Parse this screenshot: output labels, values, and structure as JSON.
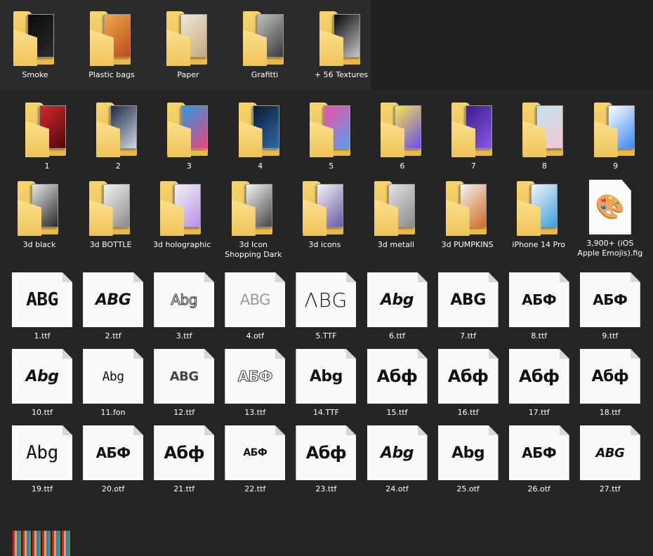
{
  "rows": [
    {
      "id": "textures",
      "kind": "folder",
      "items": [
        {
          "label": "Smoke",
          "colors": [
            "#0a0a0a",
            "#2b2b2b"
          ]
        },
        {
          "label": "Plastic bags",
          "colors": [
            "#f2a94a",
            "#b84a1c"
          ]
        },
        {
          "label": "Paper",
          "colors": [
            "#efe8dc",
            "#c9a77a"
          ]
        },
        {
          "label": "Grafitti",
          "colors": [
            "#c0c0c0",
            "#3a3a3a"
          ]
        },
        {
          "label": "+ 56 Textures",
          "colors": [
            "#050505",
            "#c8c8c8"
          ]
        }
      ]
    },
    {
      "id": "gradients",
      "kind": "folder",
      "items": [
        {
          "label": "1",
          "colors": [
            "#d8262b",
            "#4a0a0c"
          ]
        },
        {
          "label": "2",
          "colors": [
            "#1e2a44",
            "#cfd6e4"
          ]
        },
        {
          "label": "3",
          "colors": [
            "#2b9be0",
            "#e8447a"
          ]
        },
        {
          "label": "4",
          "colors": [
            "#0b1a2e",
            "#2f6aa8"
          ]
        },
        {
          "label": "5",
          "colors": [
            "#f04fa0",
            "#55a0f0"
          ]
        },
        {
          "label": "6",
          "colors": [
            "#f7e64a",
            "#6a4cf0"
          ]
        },
        {
          "label": "7",
          "colors": [
            "#3a1e8a",
            "#8a58e8"
          ]
        },
        {
          "label": "8",
          "colors": [
            "#c6e4ee",
            "#f2c6d4"
          ]
        },
        {
          "label": "9",
          "colors": [
            "#ffffff",
            "#3a88f0"
          ]
        }
      ]
    },
    {
      "id": "3d",
      "kind": "mixed",
      "items": [
        {
          "type": "folder",
          "label": "3d black",
          "colors": [
            "#e6e6e6",
            "#2a2a2a"
          ]
        },
        {
          "type": "folder",
          "label": "3d BOTTLE",
          "colors": [
            "#f2f2f2",
            "#8a8a8a"
          ]
        },
        {
          "type": "folder",
          "label": "3d holographic",
          "colors": [
            "#f3f3f3",
            "#b890e8"
          ]
        },
        {
          "type": "folder",
          "label": "3d Icon\nShopping Dark",
          "colors": [
            "#f4f4f4",
            "#444444"
          ]
        },
        {
          "type": "folder",
          "label": "3d icons",
          "colors": [
            "#f4f4f4",
            "#6a58a8"
          ]
        },
        {
          "type": "folder",
          "label": "3d metall",
          "colors": [
            "#e4e4e4",
            "#8a8a8a"
          ]
        },
        {
          "type": "folder",
          "label": "3d PUMPKINS",
          "colors": [
            "#f4f4f4",
            "#d06a20"
          ]
        },
        {
          "type": "folder",
          "label": "iPhone 14 Pro",
          "colors": [
            "#f4f4f4",
            "#3aa0e0"
          ]
        },
        {
          "type": "figma",
          "label": "3,900+ (iOS\nApple Emojis).fig",
          "icon": "palette-icon"
        }
      ]
    },
    {
      "id": "fonts1",
      "kind": "font",
      "items": [
        {
          "label": "1.ttf",
          "glyph": "ABG"
        },
        {
          "label": "2.ttf",
          "glyph": "ABG"
        },
        {
          "label": "3.ttf",
          "glyph": "Abg"
        },
        {
          "label": "4.otf",
          "glyph": "ABG"
        },
        {
          "label": "5.TTF",
          "glyph": "ΛBG"
        },
        {
          "label": "6.ttf",
          "glyph": "Abg"
        },
        {
          "label": "7.ttf",
          "glyph": "ABG"
        },
        {
          "label": "8.ttf",
          "glyph": "АБФ"
        },
        {
          "label": "9.ttf",
          "glyph": "АБФ"
        }
      ]
    },
    {
      "id": "fonts2",
      "kind": "font",
      "items": [
        {
          "label": "10.ttf",
          "glyph": "Abg"
        },
        {
          "label": "11.fon",
          "glyph": "Abg"
        },
        {
          "label": "12.ttf",
          "glyph": "ABG"
        },
        {
          "label": "13.ttf",
          "glyph": "АБФ"
        },
        {
          "label": "14.TTF",
          "glyph": "Abg"
        },
        {
          "label": "15.ttf",
          "glyph": "Абф"
        },
        {
          "label": "16.ttf",
          "glyph": "Абф"
        },
        {
          "label": "17.ttf",
          "glyph": "Абф"
        },
        {
          "label": "18.ttf",
          "glyph": "Абф"
        }
      ]
    },
    {
      "id": "fonts3",
      "kind": "font",
      "items": [
        {
          "label": "19.ttf",
          "glyph": "Abg"
        },
        {
          "label": "20.otf",
          "glyph": "АБФ"
        },
        {
          "label": "21.ttf",
          "glyph": "Абф"
        },
        {
          "label": "22.ttf",
          "glyph": "АБФ"
        },
        {
          "label": "23.ttf",
          "glyph": "Абф"
        },
        {
          "label": "24.otf",
          "glyph": "Abg"
        },
        {
          "label": "25.otf",
          "glyph": "Abg"
        },
        {
          "label": "26.otf",
          "glyph": "АБФ"
        },
        {
          "label": "27.ttf",
          "glyph": "ABG"
        }
      ]
    }
  ]
}
